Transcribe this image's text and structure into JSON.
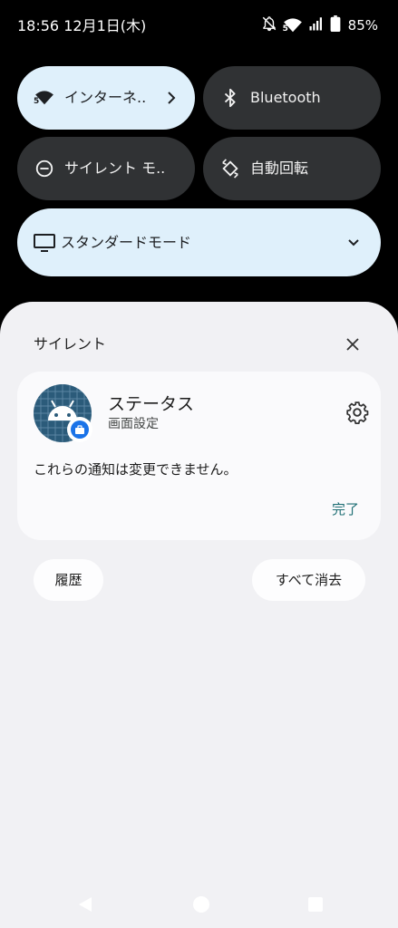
{
  "status_bar": {
    "time": "18:56",
    "date": "12月1日(木)",
    "battery_percent": "85%",
    "wifi_badge": "5",
    "icons": [
      "notifications-off-icon",
      "wifi-icon",
      "cellular-signal-icon",
      "battery-icon"
    ]
  },
  "quick_settings": {
    "internet": {
      "label": "インターネ..",
      "wifi_badge": "5",
      "icon": "wifi-icon",
      "active": true
    },
    "bluetooth": {
      "label": "Bluetooth",
      "icon": "bluetooth-icon",
      "active": false
    },
    "silent_mode": {
      "label": "サイレント モ..",
      "icon": "do-not-disturb-icon",
      "active": false
    },
    "auto_rotate": {
      "label": "自動回転",
      "icon": "auto-rotate-icon",
      "active": false
    },
    "display_mode": {
      "label": "スタンダードモード",
      "icon": "monitor-icon",
      "active": true
    }
  },
  "notification_section": {
    "title": "サイレント",
    "card": {
      "app_name": "ステータス",
      "subtitle": "画面設定",
      "message": "これらの通知は変更できません。",
      "done_label": "完了"
    },
    "history_label": "履歴",
    "clear_all_label": "すべて消去"
  },
  "colors": {
    "tile_active": "#dff0fb",
    "tile_inactive": "#303234",
    "sheet_background": "#f1f1f4",
    "card_background": "#fafafc",
    "accent_link": "#1f6f75",
    "avatar_background": "#2b5b7a"
  }
}
